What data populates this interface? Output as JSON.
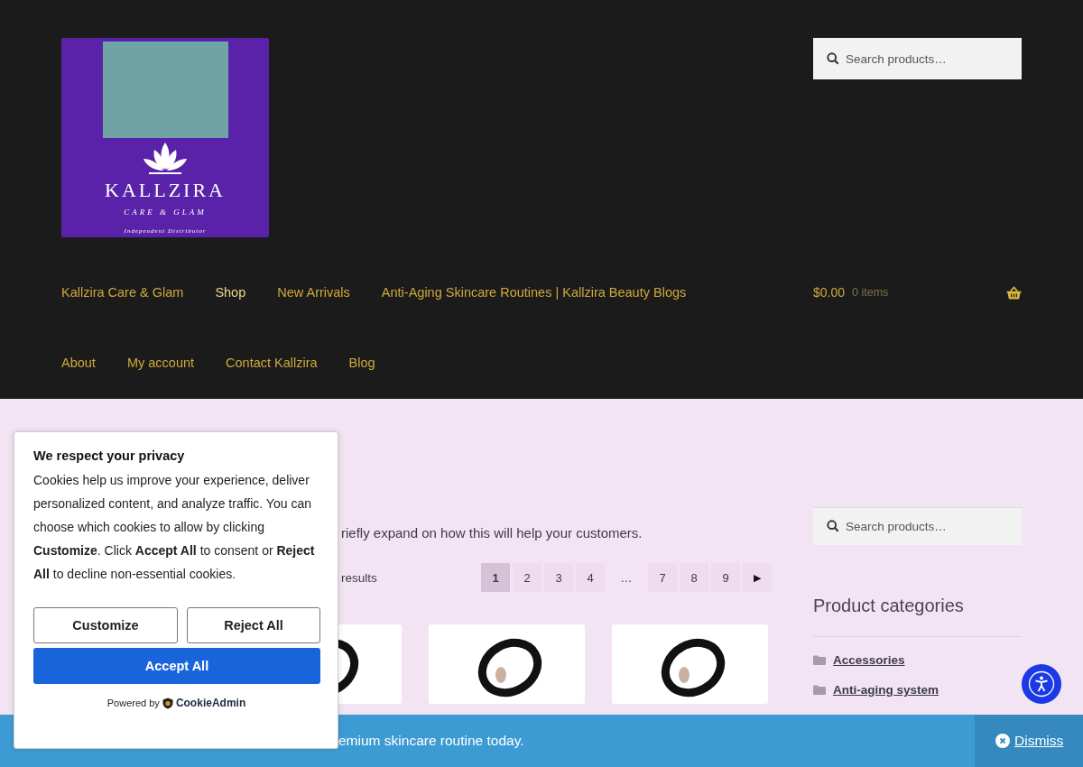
{
  "header": {
    "logo": {
      "name": "KALLZIRA",
      "tagline": "CARE & GLAM",
      "subtitle": "Independent Distributor"
    },
    "search": {
      "placeholder": "Search products…"
    },
    "nav": [
      {
        "label": "Kallzira Care & Glam",
        "selected": false
      },
      {
        "label": "Shop",
        "selected": true
      },
      {
        "label": "New Arrivals",
        "selected": false
      },
      {
        "label": "Anti-Aging Skincare Routines | Kallzira Beauty Blogs",
        "selected": false
      },
      {
        "label": "About",
        "selected": false
      },
      {
        "label": "My account",
        "selected": false
      },
      {
        "label": "Contact Kallzira",
        "selected": false
      },
      {
        "label": "Blog",
        "selected": false
      }
    ],
    "cart": {
      "total": "$0.00",
      "count": "0 items"
    }
  },
  "content": {
    "description": "riefly expand on how this will help your customers.",
    "result_count": "results",
    "pagination": [
      {
        "label": "1",
        "selected": true
      },
      {
        "label": "2",
        "selected": false
      },
      {
        "label": "3",
        "selected": false
      },
      {
        "label": "4",
        "selected": false
      },
      {
        "label": "…",
        "kind": "gap"
      },
      {
        "label": "7",
        "selected": false
      },
      {
        "label": "8",
        "selected": false
      },
      {
        "label": "9",
        "selected": false
      },
      {
        "label": "▶",
        "kind": "next",
        "selected": false
      }
    ],
    "products": [
      {
        "kind": "compact"
      },
      {
        "kind": "compact"
      },
      {
        "kind": "compact"
      }
    ]
  },
  "sidebar": {
    "search": {
      "placeholder": "Search products…"
    },
    "categories_title": "Product categories",
    "categories": [
      "Accessories",
      "Anti-aging system"
    ]
  },
  "cookie_popup": {
    "title": "We respect your privacy",
    "body": "Cookies help us improve your experience, deliver personalized content, and analyze traffic. You can choose which cookies to allow by clicking **Customize**. Click **Accept All** to consent or **Reject All** to decline non-essential cookies.",
    "buttons": [
      {
        "label": "Customize",
        "kind": "outline"
      },
      {
        "label": "Reject All",
        "kind": "outline"
      },
      {
        "label": "Accept All",
        "kind": "primary"
      }
    ],
    "powered_by": "Powered by",
    "brand": "CookieAdmin"
  },
  "notice_banner": {
    "text": "emium skincare routine today.",
    "dismiss": "Dismiss"
  }
}
